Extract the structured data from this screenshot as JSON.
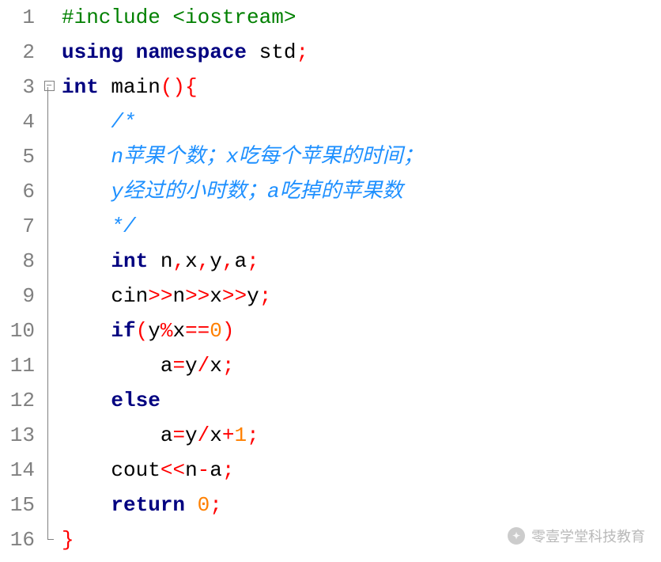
{
  "watermark": "零壹学堂科技教育",
  "code": {
    "line_numbers": [
      "1",
      "2",
      "3",
      "4",
      "5",
      "6",
      "7",
      "8",
      "9",
      "10",
      "11",
      "12",
      "13",
      "14",
      "15",
      "16"
    ],
    "fold_marker_line": 3,
    "fold_marker_glyph": "−",
    "source_text": "#include <iostream>\nusing namespace std;\nint main(){\n    /*\n    n苹果个数；x吃每个苹果的时间；\n    y经过的小时数；a吃掉的苹果数\n    */\n    int n,x,y,a;\n    cin>>n>>x>>y;\n    if(y%x==0)\n        a=y/x;\n    else\n        a=y/x+1;\n    cout<<n-a;\n    return 0;\n}",
    "lines": [
      {
        "parts": [
          {
            "t": "#include <iostream>",
            "c": "c-preproc"
          }
        ]
      },
      {
        "parts": [
          {
            "t": "using namespace",
            "c": "c-keyword"
          },
          {
            "t": " std",
            "c": "c-text"
          },
          {
            "t": ";",
            "c": "c-punct"
          }
        ]
      },
      {
        "parts": [
          {
            "t": "int",
            "c": "c-keyword"
          },
          {
            "t": " main",
            "c": "c-text"
          },
          {
            "t": "(){",
            "c": "c-brace"
          }
        ]
      },
      {
        "parts": [
          {
            "t": "    ",
            "c": ""
          },
          {
            "t": "/*",
            "c": "c-comment"
          }
        ]
      },
      {
        "parts": [
          {
            "t": "    ",
            "c": ""
          },
          {
            "t": "n苹果个数；x吃每个苹果的时间；",
            "c": "c-comment"
          }
        ]
      },
      {
        "parts": [
          {
            "t": "    ",
            "c": ""
          },
          {
            "t": "y经过的小时数；a吃掉的苹果数",
            "c": "c-comment"
          }
        ]
      },
      {
        "parts": [
          {
            "t": "    ",
            "c": ""
          },
          {
            "t": "*/",
            "c": "c-comment"
          }
        ]
      },
      {
        "parts": [
          {
            "t": "    ",
            "c": ""
          },
          {
            "t": "int",
            "c": "c-keyword"
          },
          {
            "t": " n",
            "c": "c-text"
          },
          {
            "t": ",",
            "c": "c-punct"
          },
          {
            "t": "x",
            "c": "c-text"
          },
          {
            "t": ",",
            "c": "c-punct"
          },
          {
            "t": "y",
            "c": "c-text"
          },
          {
            "t": ",",
            "c": "c-punct"
          },
          {
            "t": "a",
            "c": "c-text"
          },
          {
            "t": ";",
            "c": "c-punct"
          }
        ]
      },
      {
        "parts": [
          {
            "t": "    ",
            "c": ""
          },
          {
            "t": "cin",
            "c": "c-text"
          },
          {
            "t": ">>",
            "c": "c-punct"
          },
          {
            "t": "n",
            "c": "c-text"
          },
          {
            "t": ">>",
            "c": "c-punct"
          },
          {
            "t": "x",
            "c": "c-text"
          },
          {
            "t": ">>",
            "c": "c-punct"
          },
          {
            "t": "y",
            "c": "c-text"
          },
          {
            "t": ";",
            "c": "c-punct"
          }
        ]
      },
      {
        "parts": [
          {
            "t": "    ",
            "c": ""
          },
          {
            "t": "if",
            "c": "c-keyword"
          },
          {
            "t": "(",
            "c": "c-brace"
          },
          {
            "t": "y",
            "c": "c-text"
          },
          {
            "t": "%",
            "c": "c-punct"
          },
          {
            "t": "x",
            "c": "c-text"
          },
          {
            "t": "==",
            "c": "c-punct"
          },
          {
            "t": "0",
            "c": "c-num"
          },
          {
            "t": ")",
            "c": "c-brace"
          }
        ]
      },
      {
        "parts": [
          {
            "t": "        ",
            "c": ""
          },
          {
            "t": "a",
            "c": "c-text"
          },
          {
            "t": "=",
            "c": "c-punct"
          },
          {
            "t": "y",
            "c": "c-text"
          },
          {
            "t": "/",
            "c": "c-punct"
          },
          {
            "t": "x",
            "c": "c-text"
          },
          {
            "t": ";",
            "c": "c-punct"
          }
        ]
      },
      {
        "parts": [
          {
            "t": "    ",
            "c": ""
          },
          {
            "t": "else",
            "c": "c-keyword"
          }
        ]
      },
      {
        "parts": [
          {
            "t": "        ",
            "c": ""
          },
          {
            "t": "a",
            "c": "c-text"
          },
          {
            "t": "=",
            "c": "c-punct"
          },
          {
            "t": "y",
            "c": "c-text"
          },
          {
            "t": "/",
            "c": "c-punct"
          },
          {
            "t": "x",
            "c": "c-text"
          },
          {
            "t": "+",
            "c": "c-punct"
          },
          {
            "t": "1",
            "c": "c-num"
          },
          {
            "t": ";",
            "c": "c-punct"
          }
        ]
      },
      {
        "parts": [
          {
            "t": "    ",
            "c": ""
          },
          {
            "t": "cout",
            "c": "c-text"
          },
          {
            "t": "<<",
            "c": "c-punct"
          },
          {
            "t": "n",
            "c": "c-text"
          },
          {
            "t": "-",
            "c": "c-punct"
          },
          {
            "t": "a",
            "c": "c-text"
          },
          {
            "t": ";",
            "c": "c-punct"
          }
        ]
      },
      {
        "parts": [
          {
            "t": "    ",
            "c": ""
          },
          {
            "t": "return",
            "c": "c-keyword"
          },
          {
            "t": " ",
            "c": ""
          },
          {
            "t": "0",
            "c": "c-num"
          },
          {
            "t": ";",
            "c": "c-punct"
          }
        ]
      },
      {
        "parts": [
          {
            "t": "}",
            "c": "c-brace"
          }
        ]
      }
    ]
  }
}
